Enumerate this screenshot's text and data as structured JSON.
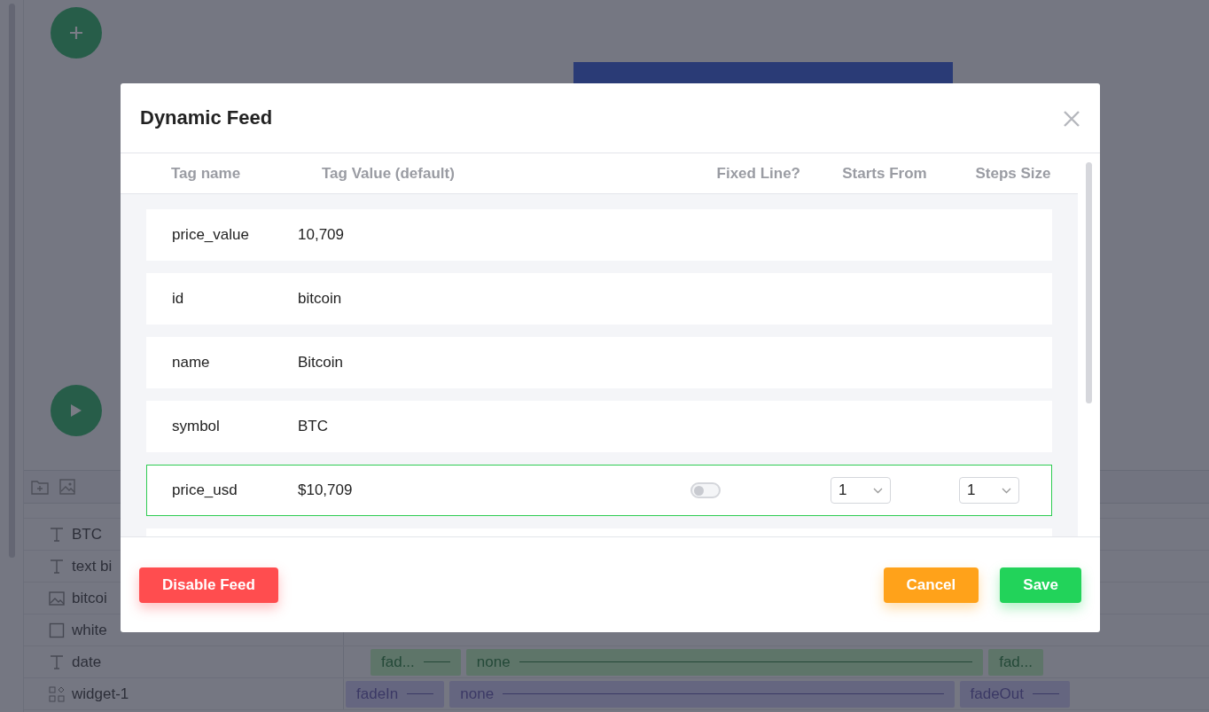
{
  "editor": {
    "layers": [
      {
        "name": "BTC",
        "kind": "text"
      },
      {
        "name": "text bi",
        "kind": "text"
      },
      {
        "name": "bitcoi",
        "kind": "image"
      },
      {
        "name": "white",
        "kind": "shape"
      },
      {
        "name": "date",
        "kind": "text",
        "tracks": [
          {
            "label": "fad...",
            "kind": "in"
          },
          {
            "label": "none",
            "kind": "mid"
          },
          {
            "label": "fad...",
            "kind": "out"
          }
        ]
      },
      {
        "name": "widget-1",
        "kind": "widget",
        "tracks": [
          {
            "label": "fadeIn",
            "kind": "in"
          },
          {
            "label": "none",
            "kind": "mid"
          },
          {
            "label": "fadeOut",
            "kind": "out"
          }
        ]
      }
    ]
  },
  "dialog": {
    "title": "Dynamic Feed",
    "columns": [
      "Tag name",
      "Tag Value (default)",
      "Fixed Line?",
      "Starts From",
      "Steps Size"
    ],
    "rows": [
      {
        "tag": "price_value",
        "value": "10,709",
        "selected": false
      },
      {
        "tag": "id",
        "value": "bitcoin",
        "selected": false
      },
      {
        "tag": "name",
        "value": "Bitcoin",
        "selected": false
      },
      {
        "tag": "symbol",
        "value": "BTC",
        "selected": false
      },
      {
        "tag": "price_usd",
        "value": "$10,709",
        "selected": true,
        "fixed_line": false,
        "starts_from": "1",
        "steps_size": "1"
      }
    ],
    "buttons": [
      {
        "label": "Disable Feed",
        "kind": "danger"
      },
      {
        "label": "Cancel",
        "kind": "warning"
      },
      {
        "label": "Save",
        "kind": "success"
      }
    ]
  }
}
